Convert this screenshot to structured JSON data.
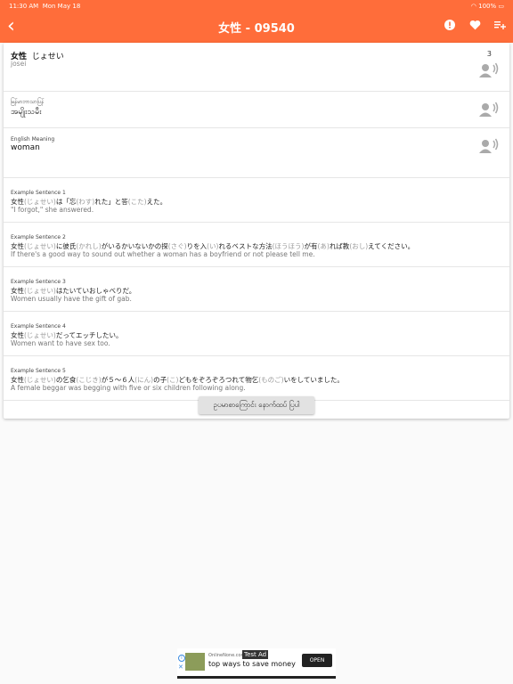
{
  "status": {
    "time": "11:30 AM",
    "date": "Mon May 18",
    "battery": "100%"
  },
  "app": {
    "title": "女性 - 09540"
  },
  "entry": {
    "word": "女性",
    "reading": "じょせい",
    "romaji": "josei",
    "level": "3",
    "myanmar_label": "မြန်မာဘာသာပြန်",
    "myanmar_meaning": "အမျိုးသမီး",
    "english_label": "English Meaning",
    "english_meaning": "woman"
  },
  "sentences": [
    {
      "label": "Example Sentence 1",
      "jp": [
        [
          "女性",
          ""
        ],
        [
          "(じょせい)",
          "r"
        ],
        [
          "は「忘",
          ""
        ],
        [
          "(わす)",
          "r"
        ],
        [
          "れた」と答",
          ""
        ],
        [
          "(こた)",
          "r"
        ],
        [
          "えた。",
          ""
        ]
      ],
      "en": "\"I forgot,\" she answered."
    },
    {
      "label": "Example Sentence 2",
      "jp": [
        [
          "女性",
          ""
        ],
        [
          "(じょせい)",
          "r"
        ],
        [
          "に彼氏",
          ""
        ],
        [
          "(かれし)",
          "r"
        ],
        [
          "がいるかいないかの探",
          ""
        ],
        [
          "(さぐ)",
          "r"
        ],
        [
          "りを入",
          ""
        ],
        [
          "(い)",
          "r"
        ],
        [
          "れるベストな方法",
          ""
        ],
        [
          "(ほうほう)",
          "r"
        ],
        [
          "が有",
          ""
        ],
        [
          "(あ)",
          "r"
        ],
        [
          "れば教",
          ""
        ],
        [
          "(おし)",
          "r"
        ],
        [
          "えてください。",
          ""
        ]
      ],
      "en": "If there's a good way to sound out whether a woman has a boyfriend or not please tell me."
    },
    {
      "label": "Example Sentence 3",
      "jp": [
        [
          "女性",
          ""
        ],
        [
          "(じょせい)",
          "r"
        ],
        [
          "はたいていおしゃべりだ。",
          ""
        ]
      ],
      "en": "Women usually have the gift of gab."
    },
    {
      "label": "Example Sentence 4",
      "jp": [
        [
          "女性",
          ""
        ],
        [
          "(じょせい)",
          "r"
        ],
        [
          "だってエッチしたい。",
          ""
        ]
      ],
      "en": "Women want to have sex too."
    },
    {
      "label": "Example Sentence 5",
      "jp": [
        [
          "女性",
          ""
        ],
        [
          "(じょせい)",
          "r"
        ],
        [
          "の乞食",
          ""
        ],
        [
          "(こじき)",
          "r"
        ],
        [
          "が５～６人",
          ""
        ],
        [
          "(にん)",
          "r"
        ],
        [
          "の子",
          ""
        ],
        [
          "(こ)",
          "r"
        ],
        [
          "どもをぞろぞろつれて物乞",
          ""
        ],
        [
          "(ものご)",
          "r"
        ],
        [
          "いをしていました。",
          ""
        ]
      ],
      "en": "A female beggar was begging with five or six children following along."
    }
  ],
  "more_button": "ဥပမာစာကြောင်း နောက်ထပ် ပြပါ",
  "ad": {
    "tag": "Test Ad",
    "source": "OnlineNone.com",
    "headline": "top ways to save money",
    "cta": "OPEN"
  },
  "icons": [
    "back-icon",
    "info-icon",
    "heart-icon",
    "add-list-icon",
    "speaker-icon",
    "wifi-icon",
    "battery-icon",
    "adchoices-icon",
    "close-icon"
  ],
  "colors": {
    "accent": "#ff6d3a"
  }
}
